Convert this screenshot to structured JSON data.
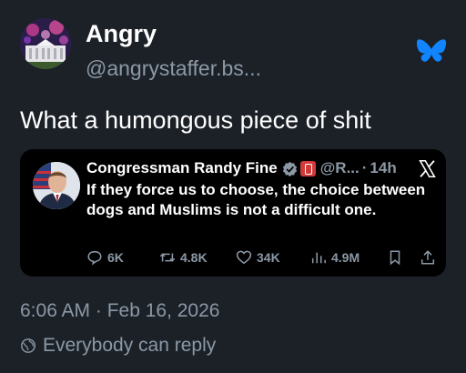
{
  "post": {
    "author_name": "Angry",
    "author_handle": "@angrystaffer.bs...",
    "text": "What a humongous piece of shit",
    "timestamp": "6:06 AM · Feb 16, 2026",
    "reply_setting": "Everybody can reply"
  },
  "quoted": {
    "name": "Congressman Randy Fine",
    "handle": "@R...",
    "time": "14h",
    "separator": "·",
    "text": "If they force us to choose, the choice between dogs and Muslims is not a difficult one.",
    "actions": {
      "replies": "6K",
      "reposts": "4.8K",
      "likes": "34K",
      "views": "4.9M"
    }
  },
  "icons": {
    "brand": "bluesky-butterfly-icon",
    "quoted_source": "x-logo-icon"
  },
  "colors": {
    "background": "#1c2128",
    "quote_background": "#000000",
    "muted_text": "#8b98a5",
    "bluesky_blue": "#1185fe",
    "verified_blue": "#1d9bf0"
  }
}
